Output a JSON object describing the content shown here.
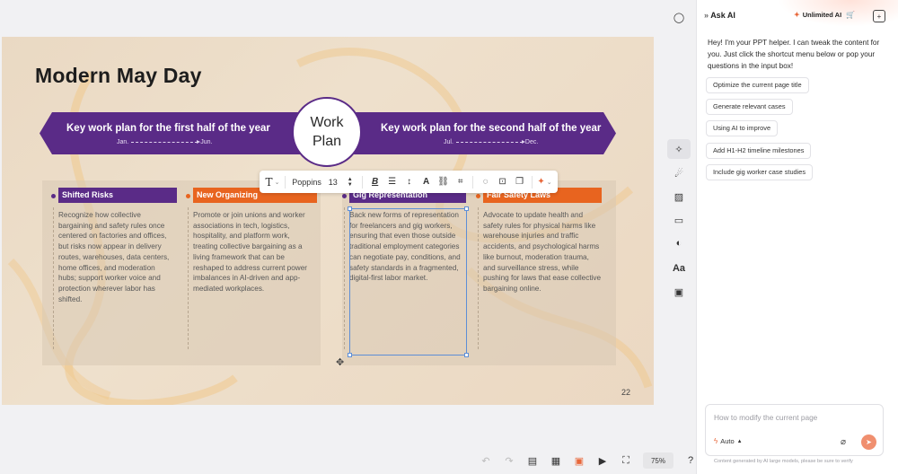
{
  "slide": {
    "title": "Modern May Day",
    "banner_left": {
      "text": "Key work plan for the first half of the year",
      "from": "Jan.",
      "to": "Jun."
    },
    "banner_right": {
      "text": "Key work plan for the second half of the year",
      "from": "Jul.",
      "to": "Dec."
    },
    "circle": {
      "line1": "Work",
      "line2": "Plan"
    },
    "columns": [
      {
        "title": "Shifted Risks",
        "color": "#5a2b87",
        "body": "Recognize how collective bargaining and safety rules once centered on factories and offices, but risks now appear in delivery routes, warehouses, data centers, home offices, and moderation hubs; support worker voice and protection wherever labor has shifted."
      },
      {
        "title": "New Organizing",
        "color": "#e8641f",
        "body": "Promote or join unions and worker associations in tech, logistics, hospitality, and platform work, treating collective bargaining as a living framework that can be reshaped to address current power imbalances in AI-driven and app-mediated workplaces."
      },
      {
        "title": "Gig Representation",
        "color": "#5a2b87",
        "body": "Back new forms of representation for freelancers and gig workers, ensuring that even those outside traditional employment categories can negotiate pay, conditions, and safety standards in a fragmented, digital-first labor market."
      },
      {
        "title": "Fair Safety Laws",
        "color": "#e8641f",
        "body": "Advocate to update health and safety rules for physical harms like warehouse injuries and traffic accidents, and psychological harms like burnout, moderation trauma, and surveillance stress, while pushing for laws that ease collective bargaining online."
      }
    ],
    "page_number": "22"
  },
  "text_toolbar": {
    "text_icon": "T",
    "font": "Poppins",
    "size": "13"
  },
  "bottom_bar": {
    "zoom": "75%"
  },
  "panel": {
    "title": "Ask AI",
    "badge": "Unlimited AI",
    "intro": "Hey! I'm your PPT helper. I can tweak the content for you. Just click the shortcut menu below or pop your questions in the input box!",
    "suggestions": [
      "Optimize the current page title",
      "Generate relevant cases",
      "Using AI to improve",
      "Add H1-H2 timeline milestones",
      "Include gig worker case studies"
    ],
    "input_placeholder": "How to modify the current page",
    "mode": "Auto",
    "footer": "Content generated by AI large models, please be sure to verify"
  }
}
